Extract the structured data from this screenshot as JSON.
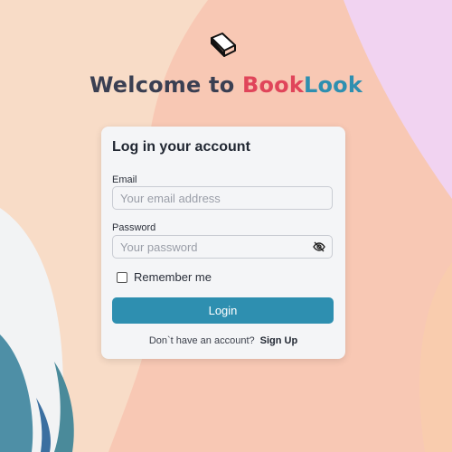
{
  "header": {
    "welcome_prefix": "Welcome to ",
    "brand_part1": "Book",
    "brand_part2": "Look",
    "logo_icon": "book-icon"
  },
  "card": {
    "title": "Log in your account",
    "email_label": "Email",
    "email_placeholder": "Your email address",
    "email_value": "",
    "password_label": "Password",
    "password_placeholder": "Your password",
    "password_value": "",
    "remember_label": "Remember me",
    "remember_checked": false,
    "login_label": "Login",
    "no_account_text": "Don`t have an account?",
    "signup_label": "Sign Up"
  },
  "colors": {
    "primary": "#2e8fb0",
    "brand_red": "#e0455a",
    "text_dark": "#3a3f52"
  }
}
